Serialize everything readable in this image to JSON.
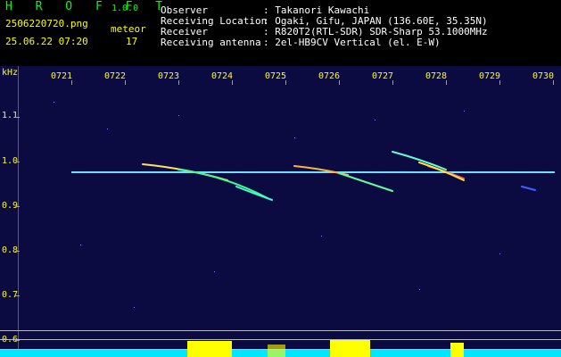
{
  "header": {
    "app_title": "H R O F F T",
    "version": "1.0.0",
    "filename": "2506220720.png",
    "meteor_label": "meteor",
    "meteor_count": "17",
    "datetime": "25.06.22 07:20",
    "info": [
      {
        "key": "Observer",
        "value": ": Takanori Kawachi"
      },
      {
        "key": "Receiving Location",
        "value": ": Ogaki, Gifu, JAPAN (136.60E, 35.35N)"
      },
      {
        "key": "Receiver",
        "value": ": R820T2(RTL-SDR) SDR-Sharp 53.1000MHz"
      },
      {
        "key": "Receiving antenna",
        "value": ": 2el-HB9CV Vertical (el. E-W)"
      }
    ]
  },
  "spectrogram": {
    "y_unit": "kHz",
    "y_labels": [
      "1.1",
      "1.0",
      "0.9",
      "0.8",
      "0.7",
      "0.6"
    ],
    "x_labels": [
      "0721",
      "0722",
      "0723",
      "0724",
      "0725",
      "0726",
      "0727",
      "0728",
      "0729",
      "0730"
    ],
    "colors": {
      "background": "#0b0b42",
      "carrier": "#6fe0ff",
      "power_bars": "#00e6ff",
      "meteor_bars": "#ffff00"
    }
  }
}
